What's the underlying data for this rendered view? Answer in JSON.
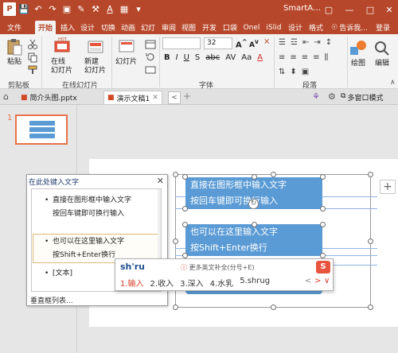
{
  "window": {
    "title": "SmartA…",
    "qat_icons": [
      "powerpoint-icon",
      "save-icon",
      "undo-icon",
      "redo-icon",
      "start-slideshow-icon",
      "paint-icon",
      "format-painter-icon",
      "font-color-icon",
      "layout-icon",
      "more-icon"
    ],
    "controls": [
      "restore-icon",
      "minimize-icon",
      "maximize-icon",
      "close-icon"
    ]
  },
  "tabs": [
    {
      "label": "文件",
      "active": false
    },
    {
      "label": "开始",
      "active": true
    },
    {
      "label": "插入",
      "active": false
    },
    {
      "label": "设计",
      "active": false
    },
    {
      "label": "切换",
      "active": false
    },
    {
      "label": "动画",
      "active": false
    },
    {
      "label": "幻灯",
      "active": false
    },
    {
      "label": "审阅",
      "active": false
    },
    {
      "label": "视图",
      "active": false
    },
    {
      "label": "开发",
      "active": false
    },
    {
      "label": "口袋",
      "active": false
    },
    {
      "label": "Onel",
      "active": false
    },
    {
      "label": "iSlid",
      "active": false
    },
    {
      "label": "设计",
      "active": false
    },
    {
      "label": "格式",
      "active": false
    }
  ],
  "tell_me": "告诉我...",
  "login": "登录",
  "ribbon": {
    "paste_label": "粘贴",
    "clipboard_group": "剪贴板",
    "online_slide_label": "在线\n幻灯片",
    "new_slide_label": "新建\n幻灯片",
    "online_slide_group": "在线幻灯片",
    "slides_label": "幻灯片",
    "font_name": "",
    "font_size": "32",
    "font_group": "字体",
    "paragraph_group": "段落",
    "draw_label": "绘图",
    "edit_label": "编辑"
  },
  "doc_tabs": {
    "tab1": "简介头图.pptx",
    "tab2": "演示文稿1",
    "right_label": "多窗口模式"
  },
  "slide_number": "1",
  "text_pane": {
    "title": "在此处键入文字",
    "items": [
      "直接在图形框中输入文字",
      "按回车键即可换行输入",
      "也可以在这里输入文字",
      "按Shift+Enter换行",
      "[文本]"
    ],
    "footer": "垂直框列表..."
  },
  "smartart": {
    "box1_line1": "直接在图形框中输入文字",
    "box1_line2": "按回车键即可换行输入",
    "box2_line1": "也可以在这里输入文字",
    "box2_line2": "按Shift+Enter换行"
  },
  "ime": {
    "input": "sh'ru",
    "hint": "更多英文补全(分号+E)",
    "candidates": [
      "1.输入",
      "2.收入",
      "3.深入",
      "4.水乳",
      "5.shrug"
    ],
    "logo": "S"
  },
  "colors": {
    "accent": "#b7472a",
    "smartart_blue": "#5b9bd5",
    "selected_slide_border": "#e8724b",
    "ime_highlight": "#d43c26"
  }
}
